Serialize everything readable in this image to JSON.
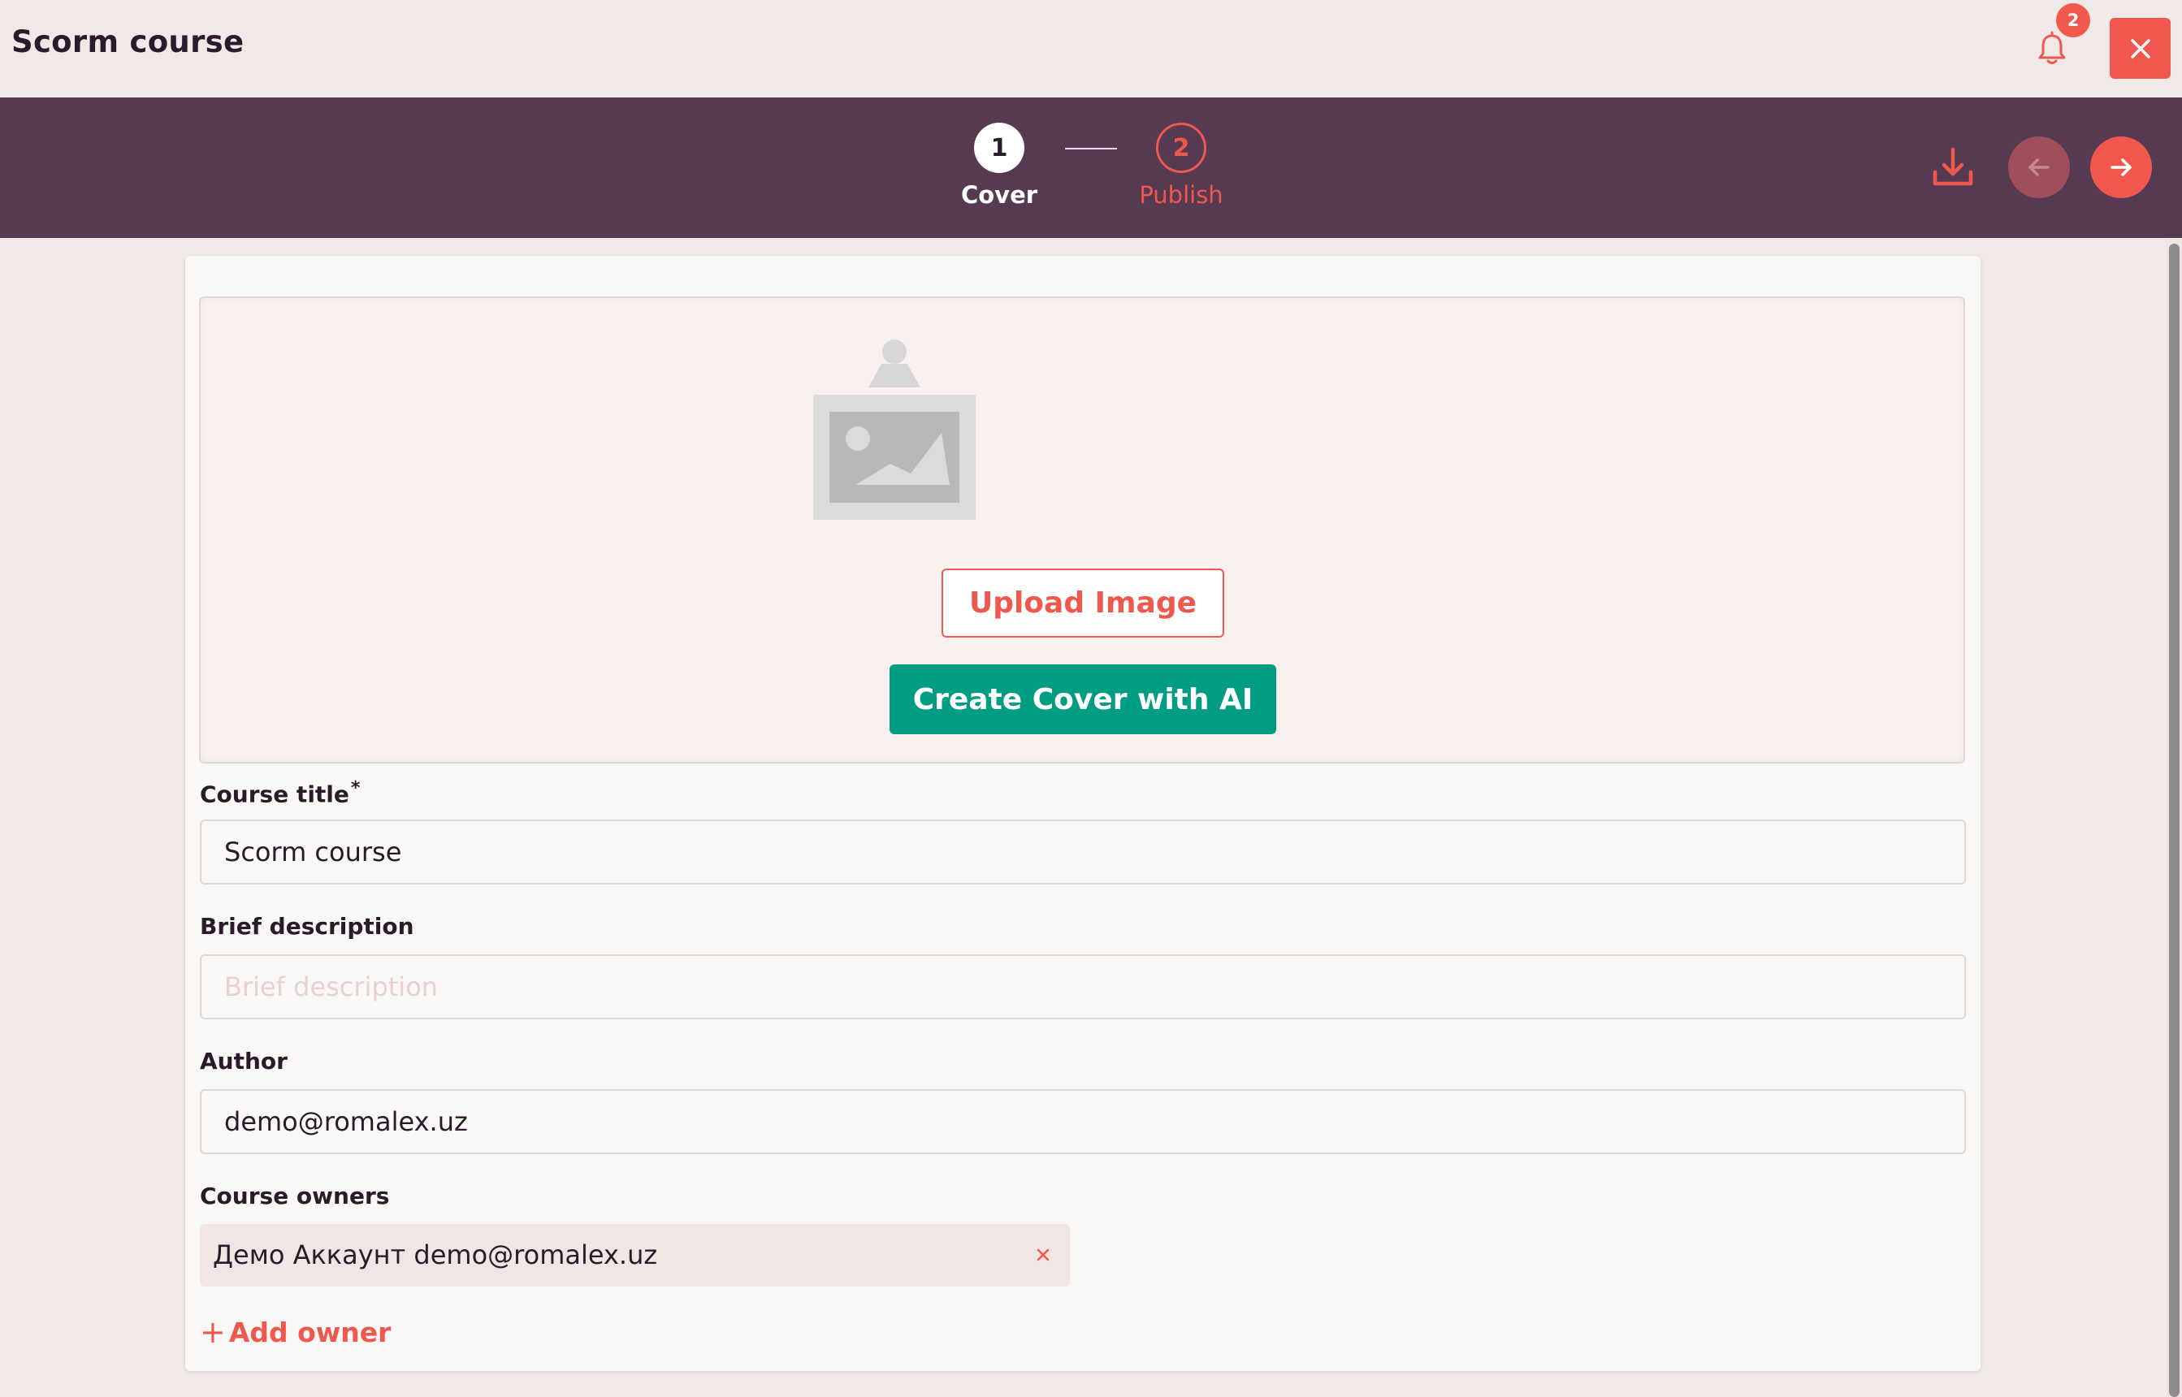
{
  "header": {
    "title": "Scorm course",
    "notifications_count": "2"
  },
  "stepper": {
    "steps": [
      {
        "number": "1",
        "label": "Cover",
        "state": "active"
      },
      {
        "number": "2",
        "label": "Publish",
        "state": "pending"
      }
    ]
  },
  "cover": {
    "upload_label": "Upload Image",
    "ai_label": "Create Cover with AI"
  },
  "form": {
    "title_label": "Course title",
    "required_mark": "*",
    "title_value": "Scorm course",
    "description_label": "Brief description",
    "description_placeholder": "Brief description",
    "description_value": "",
    "author_label": "Author",
    "author_value": "demo@romalex.uz",
    "owners_label": "Course owners",
    "owners": [
      "Демо Аккаунт demo@romalex.uz"
    ],
    "add_owner_label": "Add owner",
    "add_owner_prefix": "+"
  },
  "colors": {
    "accent": "#f0584e",
    "stepbar": "#553a51",
    "ai_button": "#009d83",
    "background": "#f1e8e8"
  },
  "icons": [
    "bell-icon",
    "close-icon",
    "download-icon",
    "arrow-left-icon",
    "arrow-right-icon",
    "image-placeholder-icon",
    "remove-icon",
    "plus-icon"
  ]
}
